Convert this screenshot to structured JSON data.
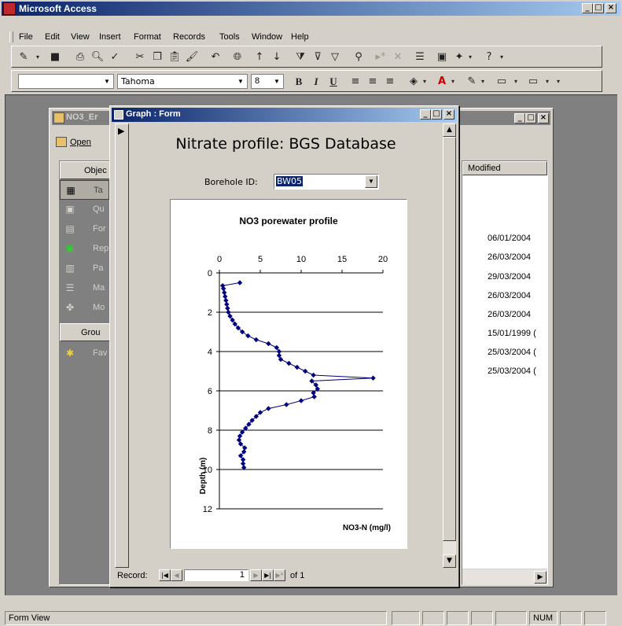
{
  "app": {
    "title": "Microsoft Access",
    "titlebar_color": "#0a246a",
    "desktop_color": "#808080",
    "face_color": "#d4d0c8"
  },
  "menu": [
    {
      "key": "file",
      "label": "File"
    },
    {
      "key": "edit",
      "label": "Edit"
    },
    {
      "key": "view",
      "label": "View"
    },
    {
      "key": "insert",
      "label": "Insert"
    },
    {
      "key": "format",
      "label": "Format"
    },
    {
      "key": "records",
      "label": "Records"
    },
    {
      "key": "tools",
      "label": "Tools"
    },
    {
      "key": "window",
      "label": "Window"
    },
    {
      "key": "help",
      "label": "Help"
    }
  ],
  "format_toolbar": {
    "object_value": "",
    "font_value": "Tahoma",
    "size_value": "8",
    "bold": "B",
    "italic": "I",
    "underline": "U"
  },
  "db_window": {
    "title": "NO3_Er",
    "open_label": "Open",
    "objects_header": "Objec",
    "objects": [
      {
        "label": "Ta",
        "icon": "table-icon"
      },
      {
        "label": "Qu",
        "icon": "query-icon"
      },
      {
        "label": "For",
        "icon": "form-icon"
      },
      {
        "label": "Rep",
        "icon": "report-icon"
      },
      {
        "label": "Pa",
        "icon": "page-icon"
      },
      {
        "label": "Ma",
        "icon": "macro-icon"
      },
      {
        "label": "Mo",
        "icon": "module-icon"
      }
    ],
    "groups_header": "Grou",
    "groups": [
      {
        "label": "Fav",
        "icon": "favorites-icon"
      }
    ],
    "modified_header": "Modified",
    "modified_dates": [
      "06/01/2004",
      "26/03/2004",
      "29/03/2004",
      "26/03/2004",
      "26/03/2004",
      "15/01/1999 (",
      "25/03/2004 (",
      "25/03/2004 ("
    ]
  },
  "graph_form": {
    "title": "Graph : Form",
    "heading": "Nitrate profile: BGS Database",
    "borehole_label": "Borehole ID:",
    "borehole_value": "BW05"
  },
  "chart_data": {
    "type": "scatter",
    "title": "NO3 porewater profile",
    "xlabel": "NO3-N (mg/l)",
    "ylabel": "Depth (m)",
    "xlim": [
      0,
      20
    ],
    "ylim": [
      12,
      0
    ],
    "x_axis_position": "top",
    "x_ticks": [
      "0",
      "5",
      "10",
      "15",
      "20"
    ],
    "y_ticks": [
      "0",
      "2",
      "4",
      "6",
      "8",
      "10",
      "12"
    ],
    "grid": "horizontal",
    "series_color": "#000080",
    "series": [
      {
        "markers": "diamond",
        "points": [
          [
            2.5,
            0.5
          ],
          [
            0.4,
            0.65
          ],
          [
            0.5,
            0.8
          ],
          [
            0.6,
            1.0
          ],
          [
            0.7,
            1.2
          ],
          [
            0.8,
            1.4
          ],
          [
            0.9,
            1.6
          ],
          [
            1.0,
            1.8
          ],
          [
            1.1,
            2.0
          ],
          [
            1.3,
            2.2
          ],
          [
            1.6,
            2.4
          ],
          [
            1.9,
            2.6
          ],
          [
            2.3,
            2.8
          ],
          [
            2.8,
            3.0
          ],
          [
            3.5,
            3.2
          ],
          [
            4.5,
            3.4
          ],
          [
            6.0,
            3.6
          ],
          [
            7.0,
            3.8
          ],
          [
            7.3,
            4.0
          ],
          [
            7.3,
            4.2
          ],
          [
            7.5,
            4.4
          ],
          [
            8.5,
            4.6
          ],
          [
            9.5,
            4.8
          ],
          [
            10.5,
            5.0
          ],
          [
            11.5,
            5.2
          ],
          [
            18.8,
            5.35
          ],
          [
            11.3,
            5.5
          ],
          [
            11.8,
            5.7
          ],
          [
            12.0,
            5.9
          ],
          [
            11.5,
            6.1
          ],
          [
            11.6,
            6.3
          ],
          [
            10.0,
            6.5
          ],
          [
            8.2,
            6.7
          ],
          [
            6.0,
            6.9
          ],
          [
            5.0,
            7.1
          ],
          [
            4.5,
            7.3
          ],
          [
            4.0,
            7.5
          ],
          [
            3.6,
            7.7
          ],
          [
            3.2,
            7.9
          ],
          [
            2.8,
            8.1
          ],
          [
            2.5,
            8.3
          ],
          [
            2.4,
            8.5
          ],
          [
            2.6,
            8.7
          ],
          [
            3.1,
            8.9
          ],
          [
            3.0,
            9.1
          ],
          [
            2.6,
            9.3
          ],
          [
            2.9,
            9.5
          ],
          [
            2.9,
            9.7
          ],
          [
            3.0,
            9.9
          ]
        ]
      }
    ]
  },
  "record_nav": {
    "label": "Record:",
    "current": "1",
    "of_text": "of 1"
  },
  "statusbar": {
    "mode": "Form View",
    "num": "NUM"
  }
}
